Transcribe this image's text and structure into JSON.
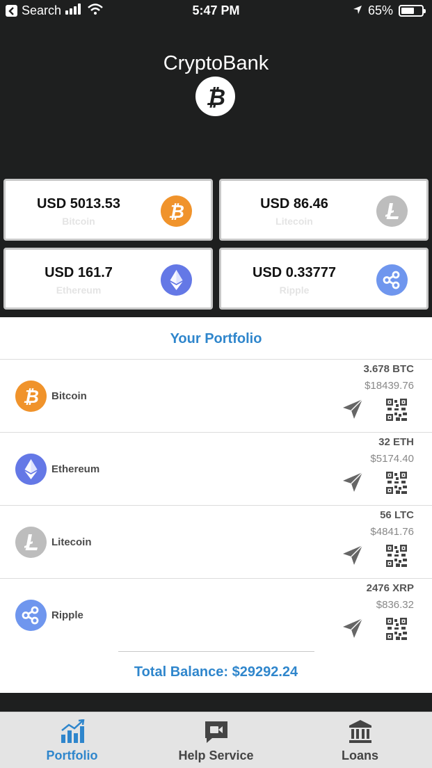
{
  "status_bar": {
    "back_label": "Search",
    "time": "5:47 PM",
    "battery": "65%"
  },
  "header": {
    "title": "CryptoBank",
    "logo_icon": "bitcoin-logo-icon"
  },
  "rates": [
    {
      "value": "USD 5013.53",
      "name": "Bitcoin",
      "icon": "bitcoin-icon",
      "color": "#f0932b"
    },
    {
      "value": "USD 86.46",
      "name": "Litecoin",
      "icon": "litecoin-icon",
      "color": "#bdbdbd"
    },
    {
      "value": "USD 161.7",
      "name": "Ethereum",
      "icon": "ethereum-icon",
      "color": "#6478e6"
    },
    {
      "value": "USD 0.33777",
      "name": "Ripple",
      "icon": "ripple-icon",
      "color": "#6f96ee"
    }
  ],
  "portfolio": {
    "title": "Your Portfolio",
    "items": [
      {
        "name": "Bitcoin",
        "amount": "3.678 BTC",
        "usd": "$18439.76"
      },
      {
        "name": "Ethereum",
        "amount": "32 ETH",
        "usd": "$5174.40"
      },
      {
        "name": "Litecoin",
        "amount": "56 LTC",
        "usd": "$4841.76"
      },
      {
        "name": "Ripple",
        "amount": "2476 XRP",
        "usd": "$836.32"
      }
    ],
    "total": "Total Balance: $29292.24"
  },
  "tabs": [
    {
      "label": "Portfolio",
      "icon": "chart-icon",
      "active": true
    },
    {
      "label": "Help Service",
      "icon": "chat-video-icon",
      "active": false
    },
    {
      "label": "Loans",
      "icon": "bank-icon",
      "active": false
    }
  ],
  "colors": {
    "accent": "#2f86cc",
    "header_bg": "#1e1f1f"
  }
}
